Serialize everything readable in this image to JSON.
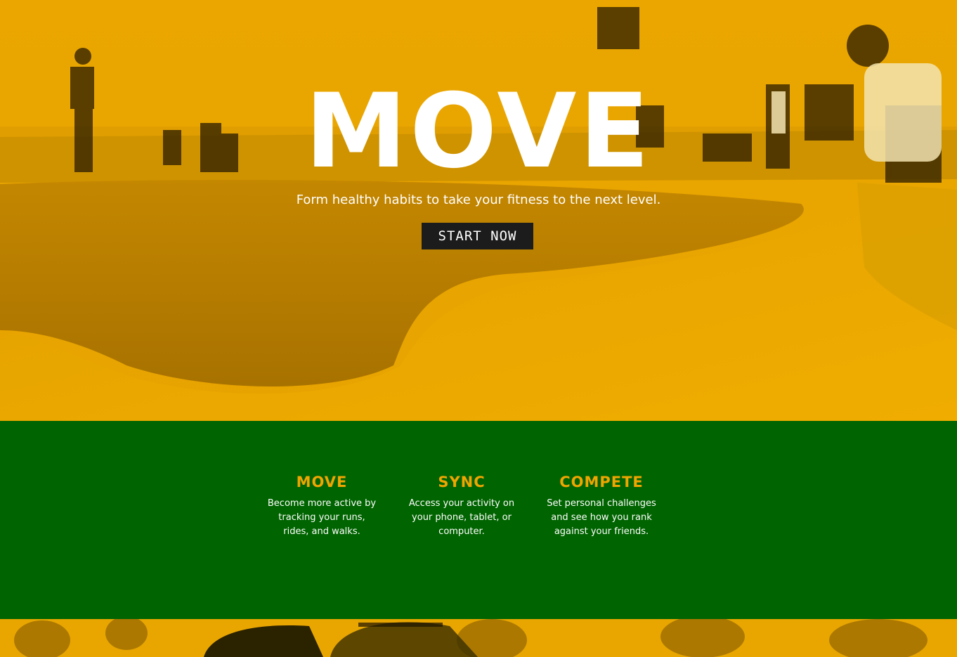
{
  "hero": {
    "title": "MOVE",
    "subtitle": "Form healthy habits to take your fitness to the next level.",
    "cta_label": "START NOW",
    "background_image": "skatepark-photo",
    "overlay_color": "#f0a500"
  },
  "features": {
    "background_color": "#006400",
    "accent_color": "#f0a500",
    "items": [
      {
        "title": "MOVE",
        "text": "Become more active by tracking your runs, rides, and walks."
      },
      {
        "title": "SYNC",
        "text": "Access your activity on your phone, tablet, or computer."
      },
      {
        "title": "COMPETE",
        "text": "Set personal challenges and see how you rank against your friends."
      }
    ]
  },
  "bottom_strip": {
    "background_image": "helmet-crowd-photo"
  }
}
